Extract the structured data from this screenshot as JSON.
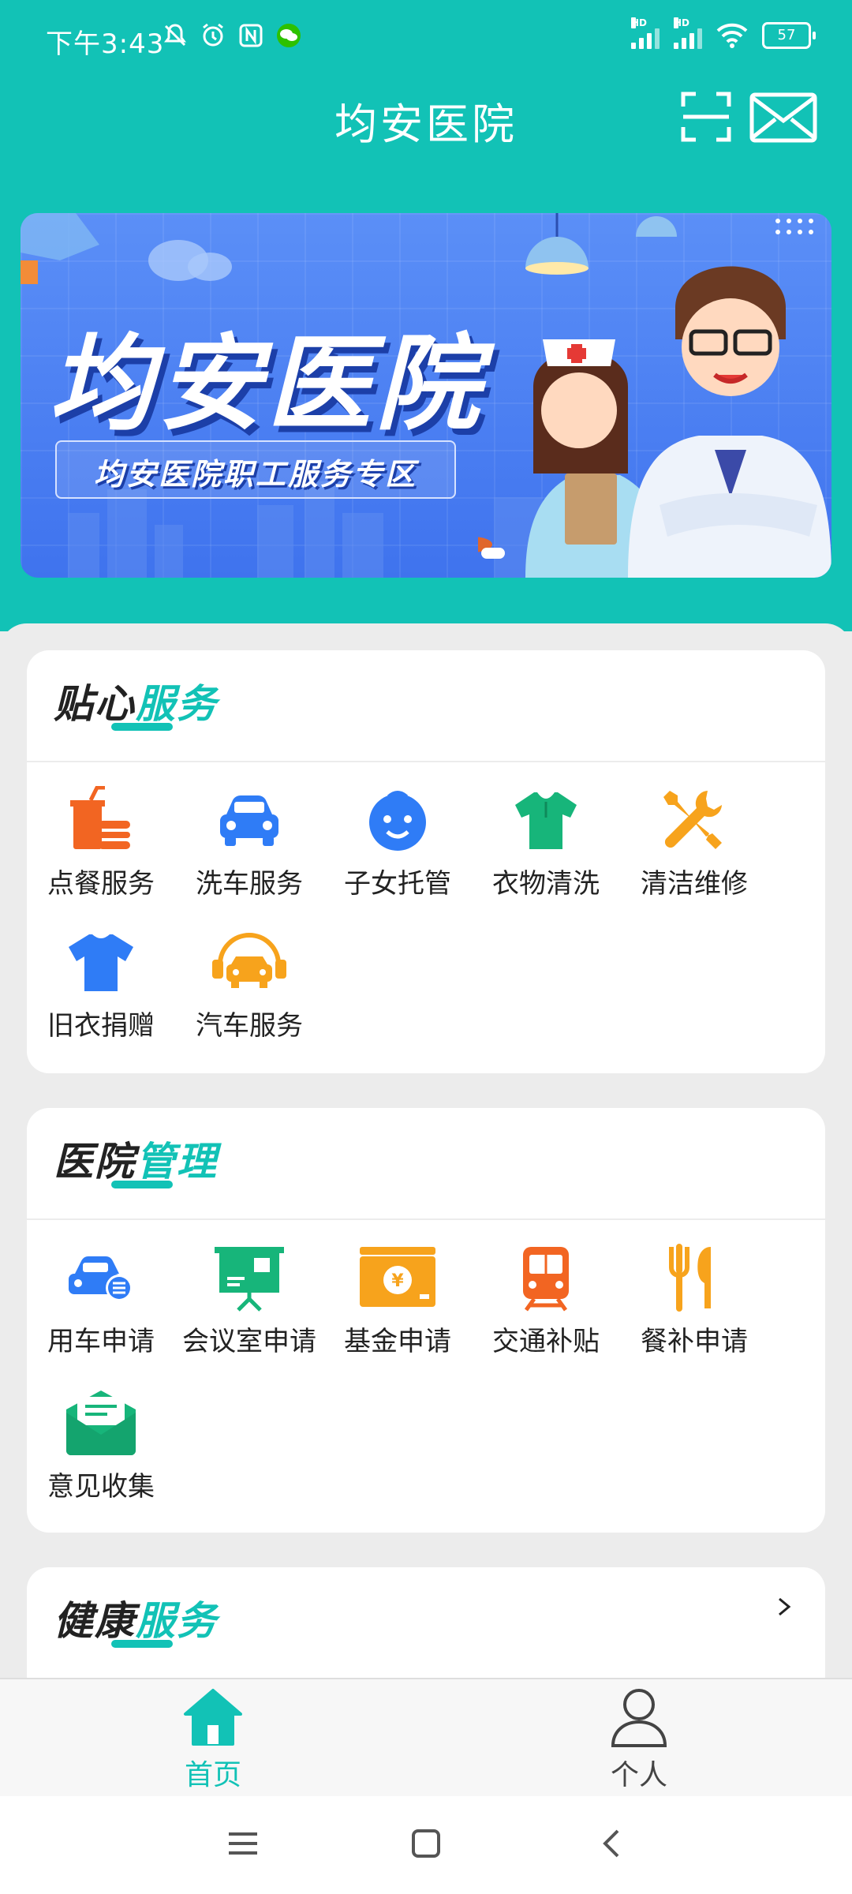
{
  "status_bar": {
    "time": "下午3:43",
    "battery": "57",
    "left_icons": [
      "bell-off-icon",
      "alarm-icon",
      "nfc-icon",
      "wechat-icon"
    ],
    "right_icons": [
      "signal-hd-1-icon",
      "signal-hd-2-icon",
      "wifi-icon",
      "battery-icon"
    ]
  },
  "header": {
    "title": "均安医院",
    "scan_icon": "scan-icon",
    "mail_icon": "mail-icon"
  },
  "banner": {
    "title": "均安医院",
    "subtitle": "均安医院职工服务专区"
  },
  "sections": [
    {
      "title_dark": "贴心",
      "title_accent": "服务",
      "items": [
        {
          "label": "点餐服务",
          "icon": "meal-icon",
          "color": "#f26522"
        },
        {
          "label": "洗车服务",
          "icon": "car-wash-icon",
          "color": "#2f7cf6"
        },
        {
          "label": "子女托管",
          "icon": "child-care-icon",
          "color": "#2f7cf6"
        },
        {
          "label": "衣物清洗",
          "icon": "shirt-icon",
          "color": "#17b57a"
        },
        {
          "label": "清洁维修",
          "icon": "tools-icon",
          "color": "#f7a31c"
        },
        {
          "label": "旧衣捐赠",
          "icon": "tshirt-icon",
          "color": "#2f7cf6"
        },
        {
          "label": "汽车服务",
          "icon": "car-service-icon",
          "color": "#f7a31c"
        }
      ]
    },
    {
      "title_dark": "医院",
      "title_accent": "管理",
      "items": [
        {
          "label": "用车申请",
          "icon": "vehicle-request-icon",
          "color": "#2f7cf6"
        },
        {
          "label": "会议室申请",
          "icon": "meeting-room-icon",
          "color": "#17b57a"
        },
        {
          "label": "基金申请",
          "icon": "fund-icon",
          "color": "#f7a31c"
        },
        {
          "label": "交通补贴",
          "icon": "train-icon",
          "color": "#f26522"
        },
        {
          "label": "餐补申请",
          "icon": "utensils-icon",
          "color": "#f7a31c"
        },
        {
          "label": "意见收集",
          "icon": "feedback-icon",
          "color": "#17b57a"
        }
      ]
    },
    {
      "title_dark": "健康",
      "title_accent": "服务",
      "items": []
    }
  ],
  "bottom_nav": [
    {
      "label": "首页",
      "icon": "home-icon",
      "active": true
    },
    {
      "label": "个人",
      "icon": "person-icon",
      "active": false
    }
  ],
  "system_nav": [
    "menu-icon",
    "home-square-icon",
    "back-icon"
  ],
  "colors": {
    "accent": "#12c2b6",
    "text": "#222222",
    "background": "#ececec"
  }
}
